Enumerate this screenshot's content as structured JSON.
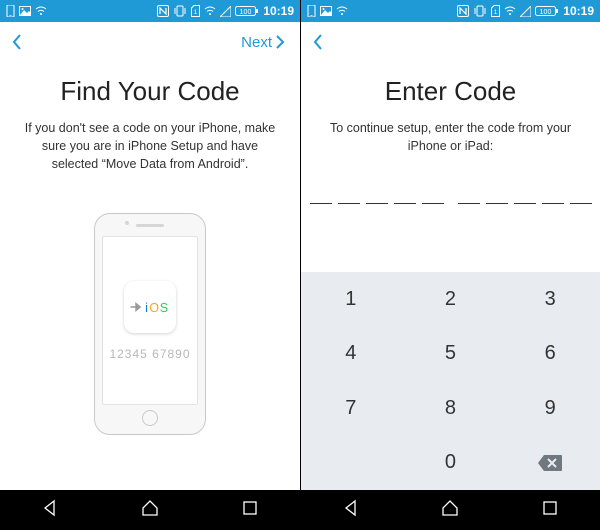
{
  "status": {
    "time": "10:19",
    "battery": "100"
  },
  "left": {
    "nextLabel": "Next",
    "title": "Find Your Code",
    "desc": "If you don't see a code on your iPhone, make sure you are in iPhone Setup and have selected “Move Data from Android”.",
    "iosArrow": "⮞",
    "exampleCode": "12345 67890"
  },
  "right": {
    "title": "Enter Code",
    "desc": "To continue setup, enter the code from your iPhone or iPad:"
  },
  "keypad": [
    "1",
    "2",
    "3",
    "4",
    "5",
    "6",
    "7",
    "8",
    "9",
    "",
    "0",
    "bksp"
  ]
}
